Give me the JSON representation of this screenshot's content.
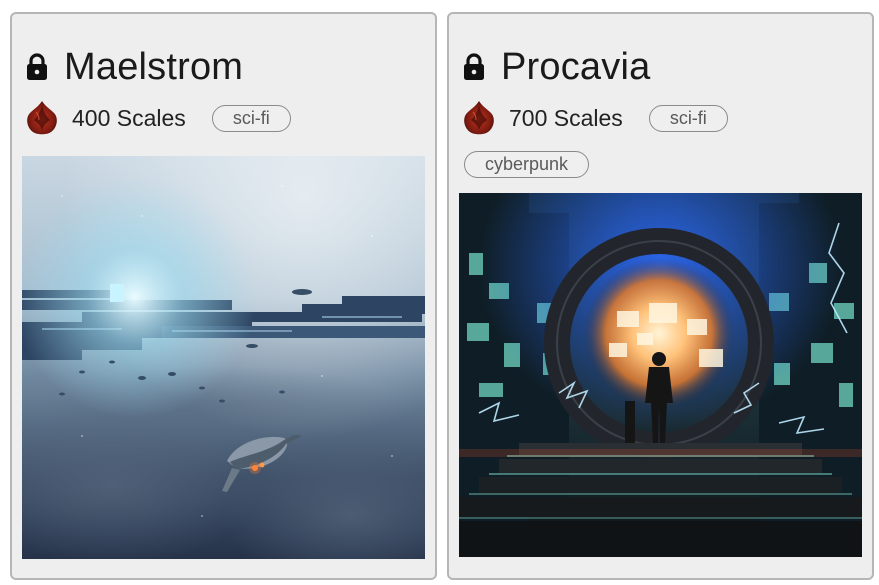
{
  "cards": [
    {
      "title": "Maelstrom",
      "locked": true,
      "lock_icon": "lock-icon",
      "currency_icon": "scale-icon",
      "price": "400 Scales",
      "tags": [
        "sci-fi"
      ],
      "artwork": "spaceship-artwork"
    },
    {
      "title": "Procavia",
      "locked": true,
      "lock_icon": "lock-icon",
      "currency_icon": "scale-icon",
      "price": "700 Scales",
      "tags": [
        "sci-fi",
        "cyberpunk"
      ],
      "artwork": "portal-artwork"
    }
  ]
}
